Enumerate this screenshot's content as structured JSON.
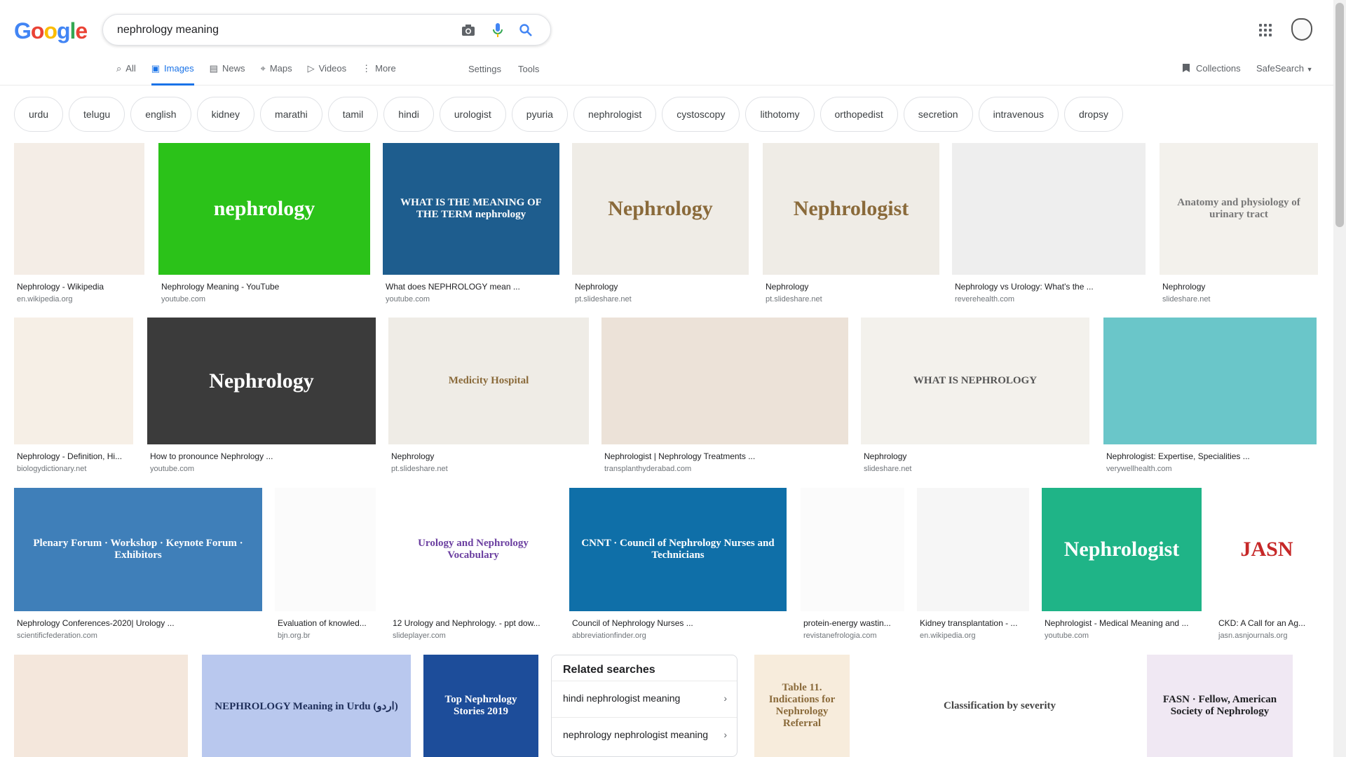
{
  "logo": {
    "letters": [
      "G",
      "o",
      "o",
      "g",
      "l",
      "e"
    ],
    "colors": [
      "#4285f4",
      "#ea4335",
      "#fbbc05",
      "#4285f4",
      "#34a853",
      "#ea4335"
    ]
  },
  "search": {
    "value": "nephrology meaning"
  },
  "tabs": [
    {
      "label": "All",
      "icon": "search-icon",
      "glyph": "⌕"
    },
    {
      "label": "Images",
      "icon": "image-icon",
      "glyph": "▣",
      "active": true
    },
    {
      "label": "News",
      "icon": "news-icon",
      "glyph": "▤"
    },
    {
      "label": "Maps",
      "icon": "map-icon",
      "glyph": "⌖"
    },
    {
      "label": "Videos",
      "icon": "video-icon",
      "glyph": "▷"
    },
    {
      "label": "More",
      "icon": "more-icon",
      "glyph": "⋮"
    }
  ],
  "tools": {
    "settings": "Settings",
    "tools": "Tools"
  },
  "header_right": {
    "collections": "Collections",
    "safesearch": "SafeSearch"
  },
  "chips": [
    "urdu",
    "telugu",
    "english",
    "kidney",
    "marathi",
    "tamil",
    "hindi",
    "urologist",
    "pyuria",
    "nephrologist",
    "cystoscopy",
    "lithotomy",
    "orthopedist",
    "secretion",
    "intravenous",
    "dropsy"
  ],
  "rows": [
    [
      {
        "caption": "Nephrology - Wikipedia",
        "source": "en.wikipedia.org",
        "bg": "#f4ede6",
        "text": "",
        "tc": "#333"
      },
      {
        "caption": "Nephrology Meaning - YouTube",
        "source": "youtube.com",
        "bg": "#2bc219",
        "text": "nephrology",
        "tc": "#ffffff"
      },
      {
        "caption": "What does NEPHROLOGY mean ...",
        "source": "youtube.com",
        "bg": "#1e5d8e",
        "text": "WHAT IS THE MEANING OF THE TERM nephrology",
        "tc": "#ffffff"
      },
      {
        "caption": "Nephrology",
        "source": "pt.slideshare.net",
        "bg": "#efece6",
        "text": "Nephrology",
        "tc": "#8a6a3a"
      },
      {
        "caption": "Nephrology",
        "source": "pt.slideshare.net",
        "bg": "#efece6",
        "text": "Nephrologist",
        "tc": "#8a6a3a"
      },
      {
        "caption": "Nephrology vs Urology: What's the ...",
        "source": "reverehealth.com",
        "bg": "#eeeeee",
        "text": "",
        "tc": "#333"
      },
      {
        "caption": "Nephrology",
        "source": "slideshare.net",
        "bg": "#f3f1ec",
        "text": "Anatomy and physiology of urinary tract",
        "tc": "#777"
      }
    ],
    [
      {
        "caption": "Nephrology - Definition, Hi...",
        "source": "biologydictionary.net",
        "bg": "#f6efe6",
        "text": "",
        "tc": "#333"
      },
      {
        "caption": "How to pronounce Nephrology ...",
        "source": "youtube.com",
        "bg": "#3b3b3b",
        "text": "Nephrology",
        "tc": "#ffffff"
      },
      {
        "caption": "Nephrology",
        "source": "pt.slideshare.net",
        "bg": "#efece6",
        "text": "Medicity Hospital",
        "tc": "#8a6a3a"
      },
      {
        "caption": "Nephrologist | Nephrology Treatments ...",
        "source": "transplanthyderabad.com",
        "bg": "#ece2d8",
        "text": "",
        "tc": "#333"
      },
      {
        "caption": "Nephrology",
        "source": "slideshare.net",
        "bg": "#f3f1ec",
        "text": "WHAT IS NEPHROLOGY",
        "tc": "#555"
      },
      {
        "caption": "Nephrologist: Expertise, Specialities ...",
        "source": "verywellhealth.com",
        "bg": "#6ac6c9",
        "text": "",
        "tc": "#333"
      }
    ],
    [
      {
        "caption": "Nephrology Conferences-2020| Urology ...",
        "source": "scientificfederation.com",
        "bg": "#3f7fb9",
        "text": "Plenary Forum · Workshop · Keynote Forum · Exhibitors",
        "tc": "#ffffff"
      },
      {
        "caption": "Evaluation of knowled...",
        "source": "bjn.org.br",
        "bg": "#fbfbfb",
        "text": "",
        "tc": "#333"
      },
      {
        "caption": "12 Urology and Nephrology. - ppt dow...",
        "source": "slideplayer.com",
        "bg": "#ffffff",
        "text": "Urology and Nephrology Vocabulary",
        "tc": "#6b3fa0"
      },
      {
        "caption": "Council of Nephrology Nurses ...",
        "source": "abbreviationfinder.org",
        "bg": "#0f6fa8",
        "text": "CNNT · Council of Nephrology Nurses and Technicians",
        "tc": "#ffffff"
      },
      {
        "caption": "protein-energy wastin...",
        "source": "revistanefrologia.com",
        "bg": "#fbfbfb",
        "text": "",
        "tc": "#333"
      },
      {
        "caption": "Kidney transplantation - ...",
        "source": "en.wikipedia.org",
        "bg": "#f6f6f6",
        "text": "",
        "tc": "#333"
      },
      {
        "caption": "Nephrologist - Medical Meaning and ...",
        "source": "youtube.com",
        "bg": "#1fb487",
        "text": "Nephrologist",
        "tc": "#ffffff"
      },
      {
        "caption": "CKD: A Call for an Ag...",
        "source": "jasn.asnjournals.org",
        "bg": "#ffffff",
        "text": "JASN",
        "tc": "#c62828"
      }
    ],
    [
      {
        "bg": "#f4e7dc",
        "text": "",
        "tc": "#333"
      },
      {
        "bg": "#b9c8ee",
        "text": "NEPHROLOGY Meaning in Urdu (اردو)",
        "tc": "#1f2f5a"
      },
      {
        "bg": "#1d4d9a",
        "text": "Top Nephrology Stories 2019",
        "tc": "#ffffff"
      },
      {
        "bg": "#f7ecdc",
        "text": "Table 11. Indications for Nephrology Referral",
        "tc": "#8a6a3a"
      },
      {
        "bg": "#ffffff",
        "text": "Classification by severity",
        "tc": "#444"
      },
      {
        "bg": "#f0e8f3",
        "text": "FASN · Fellow, American Society of Nephrology",
        "tc": "#202124"
      }
    ]
  ],
  "related": {
    "title": "Related searches",
    "items": [
      "hindi nephrologist meaning",
      "nephrology nephrologist meaning"
    ]
  }
}
